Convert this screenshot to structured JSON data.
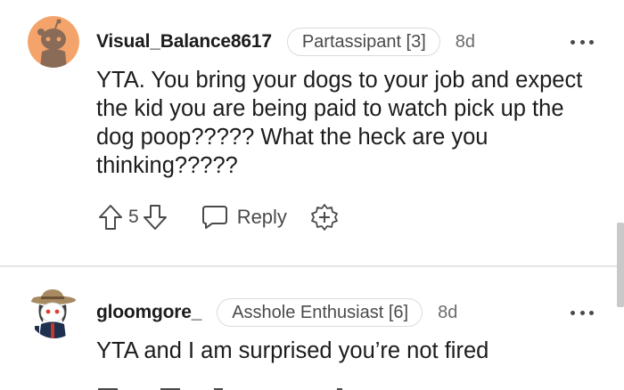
{
  "comments": [
    {
      "username": "Visual_Balance8617",
      "flair": "Partassipant [3]",
      "time": "8d",
      "body": "YTA. You bring your dogs to your job and expect the kid you are being paid to watch pick up the dog poop????? What the heck are you thinking?????",
      "score": "5",
      "reply_label": "Reply",
      "avatar_icon": "snoo-avatar-icon",
      "avatar_bg": "#f4a46a"
    },
    {
      "username": "gloomgore_",
      "flair": "Asshole Enthusiast [6]",
      "time": "8d",
      "body": "YTA and I am surprised you’re not fired",
      "avatar_icon": "snoo-cowboy-avatar-icon"
    }
  ],
  "icons": {
    "upvote": "upvote-arrow-icon",
    "downvote": "downvote-arrow-icon",
    "reply": "speech-bubble-icon",
    "award": "award-plus-icon",
    "more": "more-options-icon"
  },
  "colors": {
    "text": "#1c1c1c",
    "meta": "#4a4a4a",
    "flair_border": "#d9dbdd",
    "divider": "#e4e6e8"
  }
}
